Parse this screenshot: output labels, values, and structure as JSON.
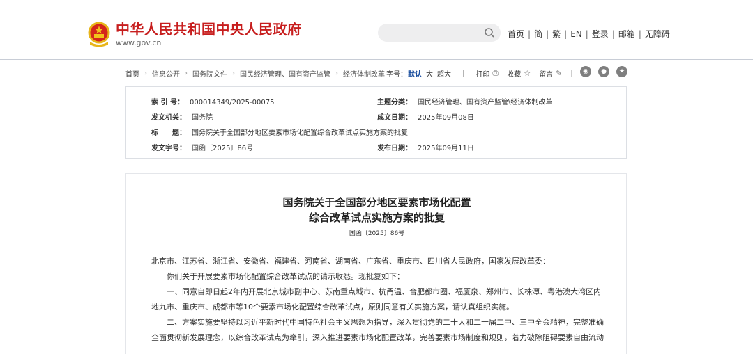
{
  "header": {
    "site_name": "中华人民共和国中央人民政府",
    "site_url": "www.gov.cn",
    "links": [
      "首页",
      "简",
      "繁",
      "EN",
      "登录",
      "邮箱",
      "无障碍"
    ],
    "search": {
      "placeholder": ""
    },
    "colors": {
      "brand_red": "#c71e1e"
    }
  },
  "breadcrumb": {
    "items": [
      "首页",
      "信息公开",
      "国务院文件",
      "国民经济管理、国有资产监管",
      "经济体制改革"
    ],
    "font_label": "字号：",
    "font_options": [
      "默认",
      "大",
      "超大"
    ],
    "tools": [
      {
        "label": "打印",
        "icon": "print-icon"
      },
      {
        "label": "收藏",
        "icon": "star-icon"
      },
      {
        "label": "留言",
        "icon": "pencil-icon"
      }
    ],
    "share_icons": [
      "weibo-icon",
      "wechat-icon",
      "qzone-icon"
    ]
  },
  "info": {
    "index_label": "索 引 号：",
    "index_value": "000014349/2025-00075",
    "category_label": "主题分类：",
    "category_value": "国民经济管理、国有资产监管\\经济体制改革",
    "issuer_label": "发文机关：",
    "issuer_value": "国务院",
    "date_label": "成文日期：",
    "date_value": "2025年09月08日",
    "title_label": "标　　题：",
    "title_value": "国务院关于全国部分地区要素市场化配置综合改革试点实施方案的批复",
    "docno_label": "发文字号：",
    "docno_value": "国函〔2025〕86号",
    "pub_label": "发布日期：",
    "pub_value": "2025年09月11日"
  },
  "article": {
    "title_line1": "国务院关于全国部分地区要素市场化配置",
    "title_line2": "综合改革试点实施方案的批复",
    "doc_no": "国函〔2025〕86号",
    "paragraphs": [
      "北京市、江苏省、浙江省、安徽省、福建省、河南省、湖南省、广东省、重庆市、四川省人民政府，国家发展改革委：",
      "　　你们关于开展要素市场化配置综合改革试点的请示收悉。现批复如下：",
      "　　一、同意自即日起2年内开展北京城市副中心、苏南重点城市、杭甬温、合肥都市圈、福厦泉、郑州市、长株潭、粤港澳大湾区内",
      "地九市、重庆市、成都市等10个要素市场化配置综合改革试点，原则同意有关实施方案，请认真组织实施。",
      "　　二、方案实施要坚持以习近平新时代中国特色社会主义思想为指导，深入贯彻党的二十大和二十届二中、三中全会精神，完整准确",
      "全面贯彻新发展理念，以综合改革试点为牵引，深入推进要素市场化配置改革，完善要素市场制度和规则，着力破除阻碍要素自由流动"
    ]
  }
}
